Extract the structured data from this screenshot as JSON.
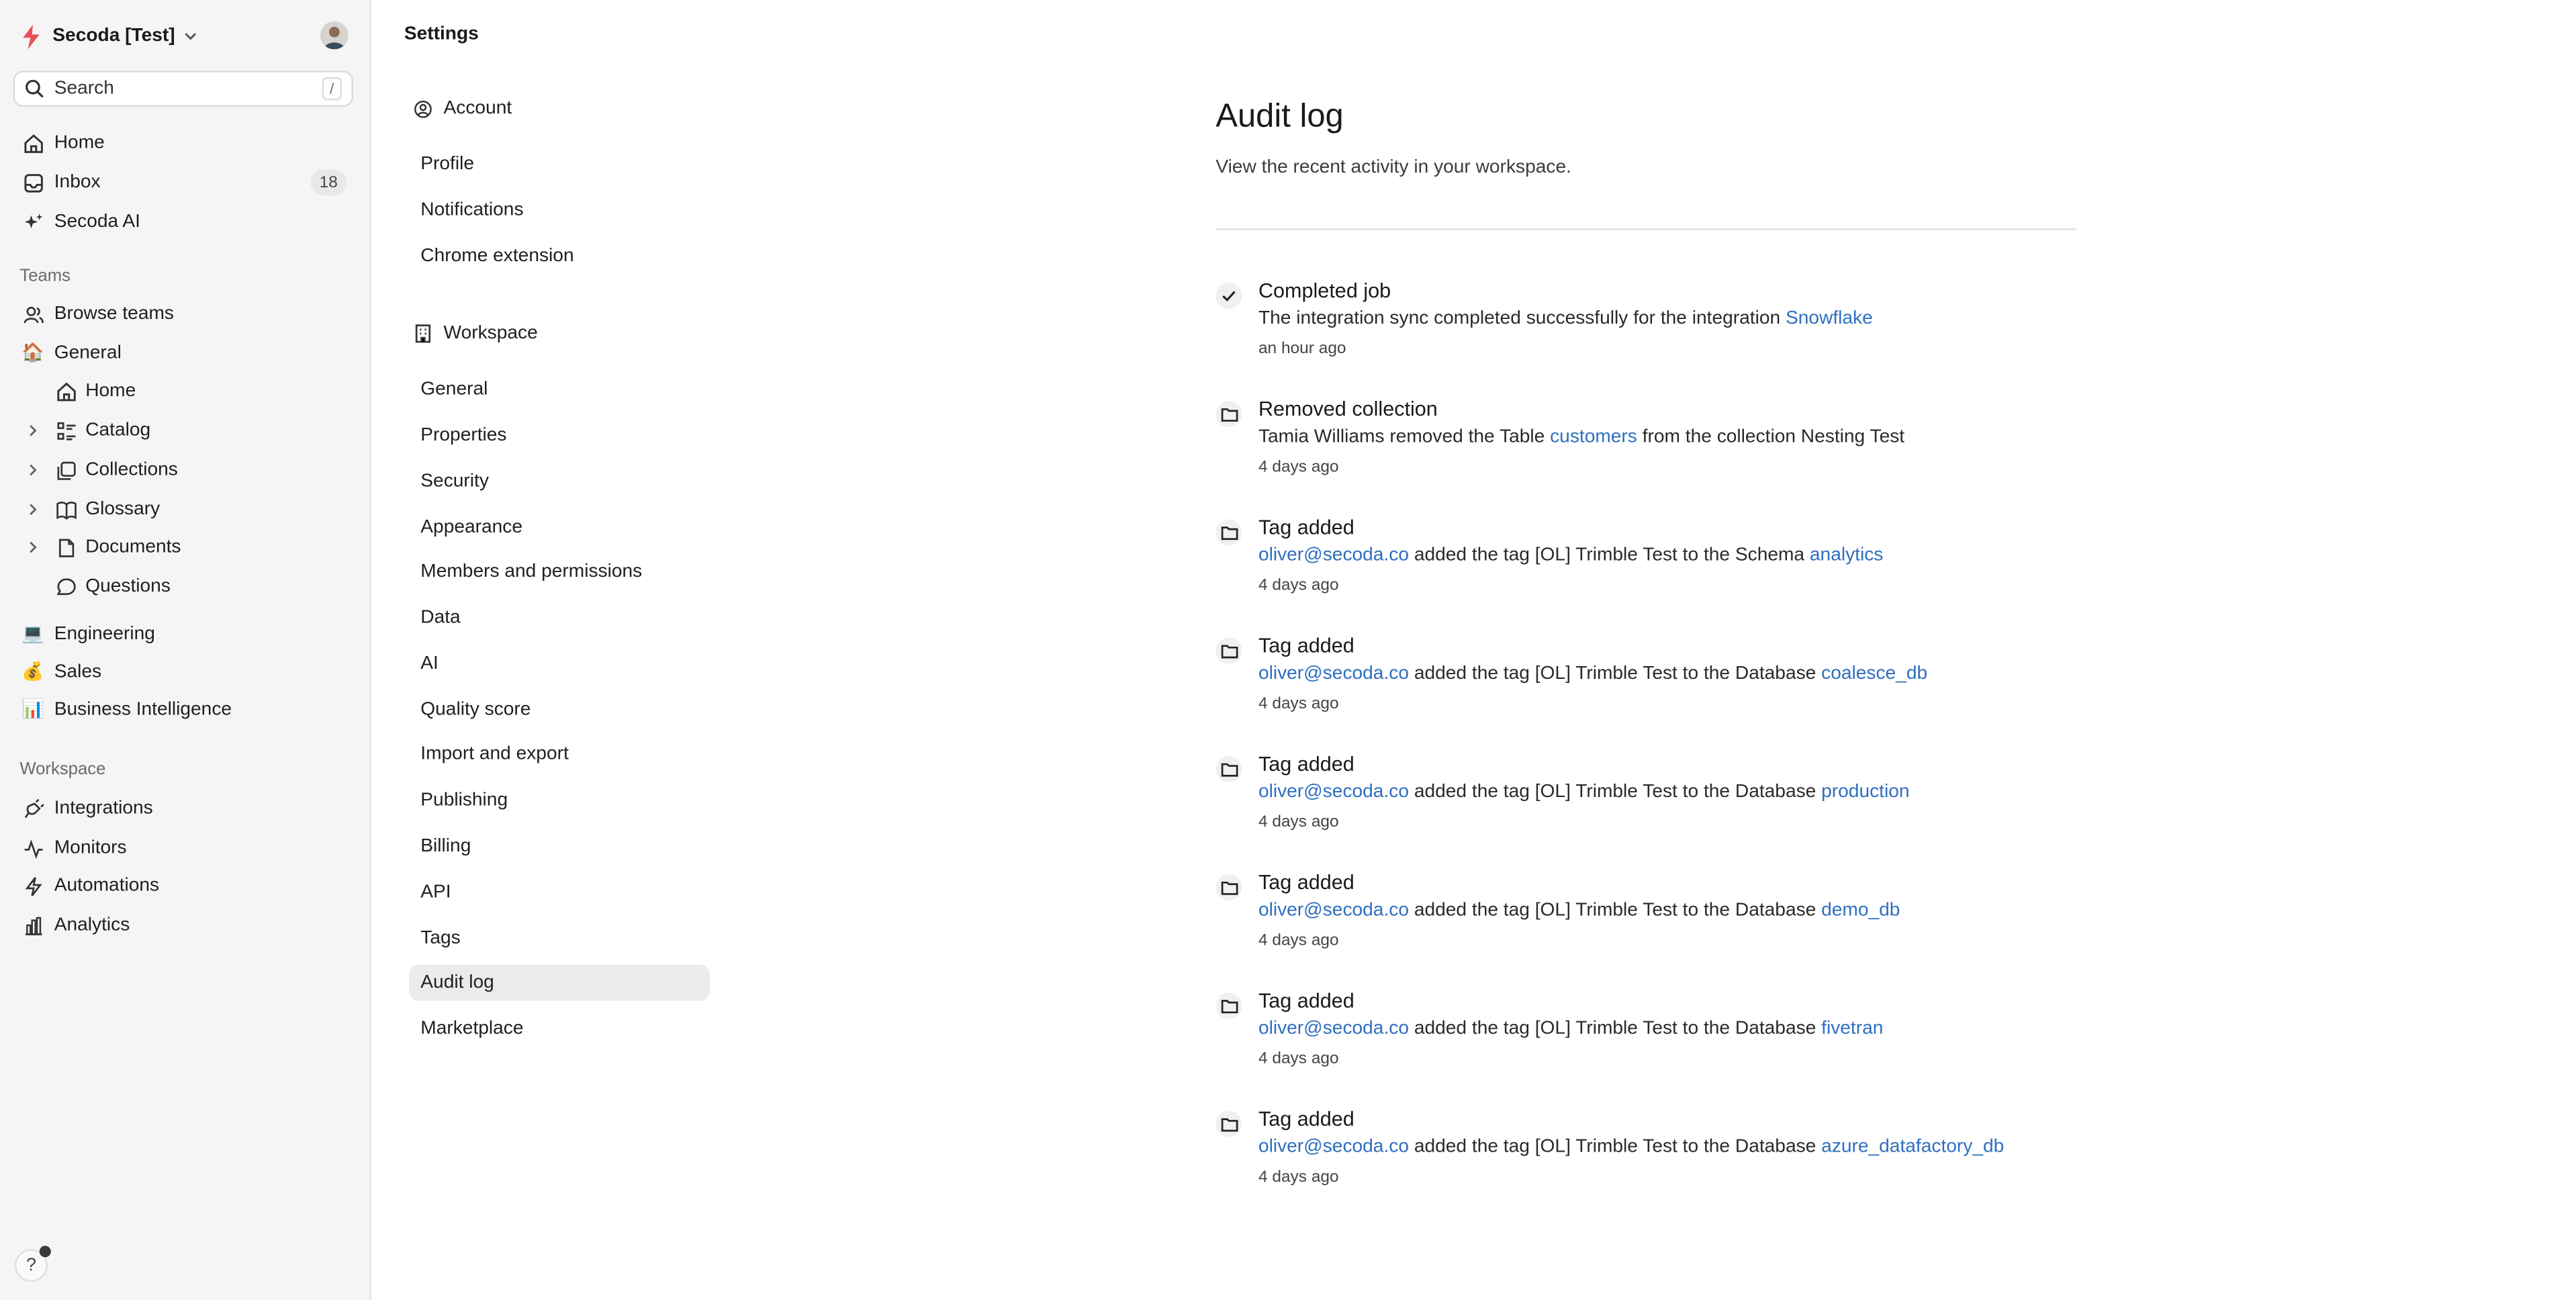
{
  "workspace": {
    "name": "Secoda [Test]"
  },
  "search": {
    "label": "Search",
    "shortcut": "/"
  },
  "nav": {
    "home": "Home",
    "inbox": "Inbox",
    "inbox_count": "18",
    "ai": "Secoda AI"
  },
  "teams": {
    "heading": "Teams",
    "browse": "Browse teams",
    "general": {
      "label": "General",
      "emoji": "🏠",
      "children": [
        "Home",
        "Catalog",
        "Collections",
        "Glossary",
        "Documents",
        "Questions"
      ]
    },
    "others": [
      {
        "label": "Engineering",
        "emoji": "💻"
      },
      {
        "label": "Sales",
        "emoji": "💰"
      },
      {
        "label": "Business Intelligence",
        "emoji": "📊"
      }
    ]
  },
  "workspace_nav": {
    "heading": "Workspace",
    "items": [
      "Integrations",
      "Monitors",
      "Automations",
      "Analytics"
    ]
  },
  "help": {
    "label": "?"
  },
  "settings": {
    "title": "Settings",
    "account": {
      "heading": "Account",
      "items": [
        "Profile",
        "Notifications",
        "Chrome extension"
      ]
    },
    "workspace": {
      "heading": "Workspace",
      "items": [
        "General",
        "Properties",
        "Security",
        "Appearance",
        "Members and permissions",
        "Data",
        "AI",
        "Quality score",
        "Import and export",
        "Publishing",
        "Billing",
        "API",
        "Tags",
        "Audit log",
        "Marketplace"
      ],
      "active": "Audit log"
    }
  },
  "main": {
    "title": "Audit log",
    "subtitle": "View the recent activity in your workspace.",
    "entries": [
      {
        "icon": "check-icon",
        "title": "Completed job",
        "pre": "The integration sync completed successfully for the integration ",
        "link": "Snowflake",
        "post": "",
        "actor": "",
        "time": "an hour ago"
      },
      {
        "icon": "folder-icon",
        "title": "Removed collection",
        "pre": "Tamia Williams removed the Table ",
        "link": "customers",
        "post": " from the collection Nesting Test",
        "actor": "",
        "time": "4 days ago"
      },
      {
        "icon": "folder-icon",
        "title": "Tag added",
        "actor": "oliver@secoda.co",
        "pre": " added the tag [OL] Trimble Test to the Schema ",
        "link": "analytics",
        "post": "",
        "time": "4 days ago"
      },
      {
        "icon": "folder-icon",
        "title": "Tag added",
        "actor": "oliver@secoda.co",
        "pre": " added the tag [OL] Trimble Test to the Database ",
        "link": "coalesce_db",
        "post": "",
        "time": "4 days ago"
      },
      {
        "icon": "folder-icon",
        "title": "Tag added",
        "actor": "oliver@secoda.co",
        "pre": " added the tag [OL] Trimble Test to the Database ",
        "link": "production",
        "post": "",
        "time": "4 days ago"
      },
      {
        "icon": "folder-icon",
        "title": "Tag added",
        "actor": "oliver@secoda.co",
        "pre": " added the tag [OL] Trimble Test to the Database ",
        "link": "demo_db",
        "post": "",
        "time": "4 days ago"
      },
      {
        "icon": "folder-icon",
        "title": "Tag added",
        "actor": "oliver@secoda.co",
        "pre": " added the tag [OL] Trimble Test to the Database ",
        "link": "fivetran",
        "post": "",
        "time": "4 days ago"
      },
      {
        "icon": "folder-icon",
        "title": "Tag added",
        "actor": "oliver@secoda.co",
        "pre": " added the tag [OL] Trimble Test to the Database ",
        "link": "azure_datafactory_db",
        "post": "",
        "time": "4 days ago"
      }
    ]
  },
  "colors": {
    "link": "#2f6fbf",
    "brand": "#e8505b",
    "sidebar_bg": "#f5f5f5",
    "active_bg": "#ebebeb"
  }
}
